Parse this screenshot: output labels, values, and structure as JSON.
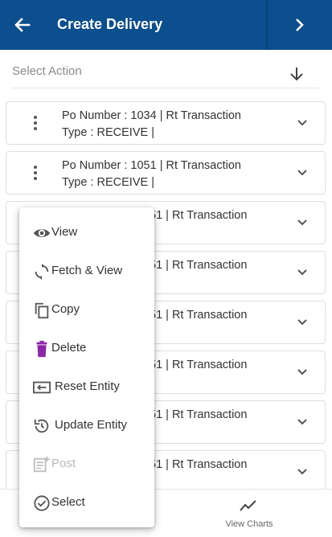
{
  "header": {
    "title": "Create Delivery",
    "back_icon": "arrow-left-icon",
    "next_icon": "chevron-right-icon",
    "background": "#0b4f8f"
  },
  "action_bar": {
    "label": "Select Action",
    "icon": "arrow-down-icon"
  },
  "items": [
    {
      "line1": "Po Number : 1034 | Rt Transaction",
      "line2": "Type : RECEIVE |"
    },
    {
      "line1": "Po Number : 1051 | Rt Transaction",
      "line2": "Type : RECEIVE |"
    },
    {
      "line1": "51 | Rt Transaction",
      "line2": ""
    },
    {
      "line1": "51 | Rt Transaction",
      "line2": ""
    },
    {
      "line1": "51 | Rt Transaction",
      "line2": ""
    },
    {
      "line1": "51 | Rt Transaction",
      "line2": ""
    },
    {
      "line1": "51 | Rt Transaction",
      "line2": ""
    },
    {
      "line1": "51 | Rt Transaction",
      "line2": ""
    }
  ],
  "context_menu": {
    "items": [
      {
        "label": "View",
        "icon": "eye-icon",
        "enabled": true
      },
      {
        "label": "Fetch & View",
        "icon": "refresh-icon",
        "enabled": true
      },
      {
        "label": "Copy",
        "icon": "copy-icon",
        "enabled": true
      },
      {
        "label": "Delete",
        "icon": "trash-icon",
        "enabled": true,
        "color": "#8e24aa"
      },
      {
        "label": "Reset Entity",
        "icon": "reset-icon",
        "enabled": true
      },
      {
        "label": "Update Entity",
        "icon": "history-icon",
        "enabled": true
      },
      {
        "label": "Post",
        "icon": "post-icon",
        "enabled": false
      },
      {
        "label": "Select",
        "icon": "check-circle-icon",
        "enabled": true
      }
    ]
  },
  "bottom_nav": {
    "view_charts_label": "View Charts",
    "view_charts_icon": "trend-line-icon"
  },
  "colors": {
    "accent": "#0b4f8f",
    "delete": "#8e24aa",
    "disabled": "#b9b9b9"
  }
}
